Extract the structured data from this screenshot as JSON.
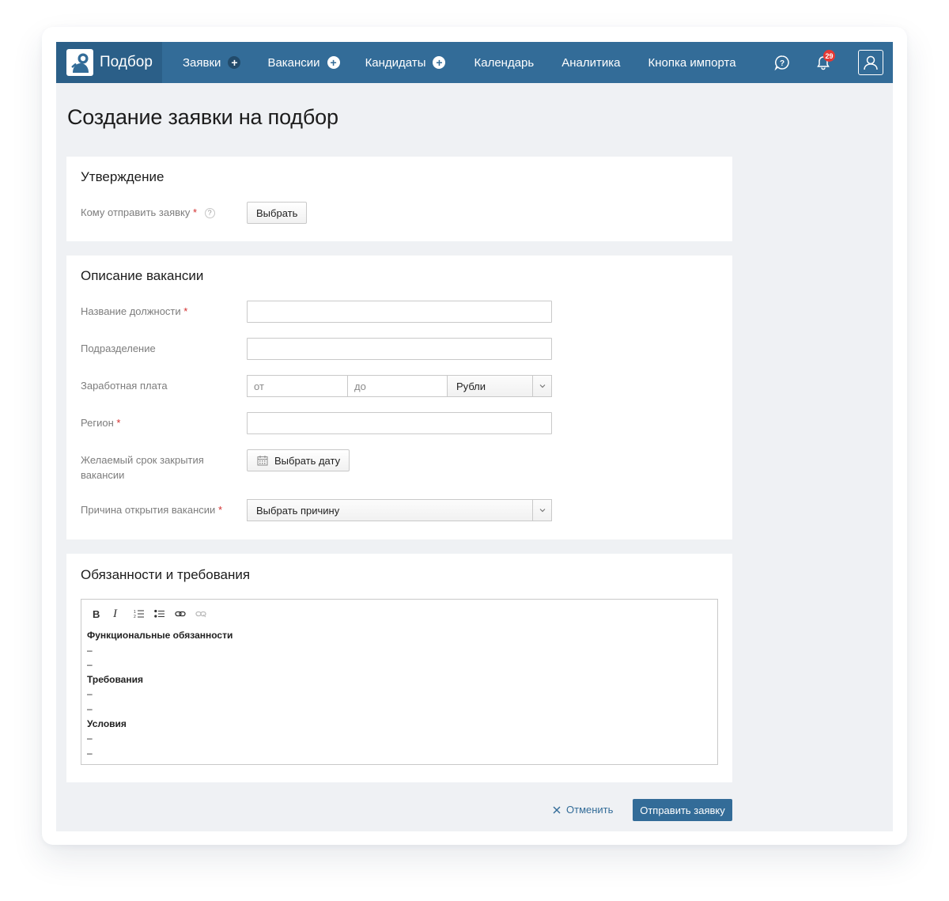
{
  "nav": {
    "brand": "Подбор",
    "items": [
      {
        "label": "Заявки",
        "has_add": true
      },
      {
        "label": "Вакансии",
        "has_add": true
      },
      {
        "label": "Кандидаты",
        "has_add": true
      },
      {
        "label": "Календарь"
      },
      {
        "label": "Аналитика"
      },
      {
        "label": "Кнопка импорта"
      }
    ],
    "notifications_count": "29",
    "icons": [
      "help-bubble-icon",
      "bell-icon",
      "user-icon"
    ],
    "colors": {
      "bar": "#336c98",
      "brand_bg": "#2b5f88",
      "badge": "#e53935"
    }
  },
  "page": {
    "title": "Создание заявки на подбор"
  },
  "approval": {
    "title": "Утверждение",
    "send_to_label": "Кому отправить заявку",
    "help_mark": "?",
    "choose_button": "Выбрать"
  },
  "vacancy": {
    "title": "Описание вакансии",
    "position_label": "Название должности",
    "position_value": "",
    "division_label": "Подразделение",
    "division_value": "",
    "salary_label": "Заработная плата",
    "salary_from_placeholder": "от",
    "salary_to_placeholder": "до",
    "currency_selected": "Рубли",
    "region_label": "Регион",
    "region_value": "",
    "deadline_label": "Желаемый срок закрытия вакансии",
    "deadline_button": "Выбрать дату",
    "reason_label": "Причина открытия вакансии",
    "reason_selected": "Выбрать причину"
  },
  "duties": {
    "title": "Обязанности и требования",
    "toolbar": [
      "bold-icon",
      "italic-icon",
      "ordered-list-icon",
      "bullet-list-icon",
      "link-icon",
      "unlink-icon"
    ],
    "bold_glyph": "B",
    "italic_glyph": "I",
    "content": {
      "h1": "Функциональные обязанности",
      "h2": "Требования",
      "h3": "Условия",
      "dash": "–"
    }
  },
  "footer": {
    "cancel_label": "Отменить",
    "submit_label": "Отправить заявку"
  }
}
